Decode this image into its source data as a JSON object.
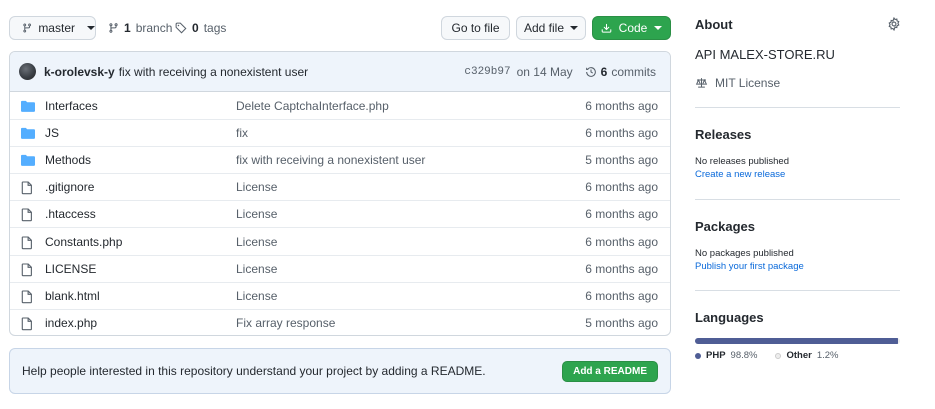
{
  "toolbar": {
    "branch_label": "master",
    "branches_count": "1",
    "branches_label": "branch",
    "tags_count": "0",
    "tags_label": "tags",
    "goto_file": "Go to file",
    "add_file": "Add file",
    "code": "Code"
  },
  "commit": {
    "author": "k-orolevsk-y",
    "message": "fix with receiving a nonexistent user",
    "sha": "c329b97",
    "date": "on 14 May",
    "count": "6",
    "count_label": "commits"
  },
  "files": [
    {
      "name": "Interfaces",
      "type": "folder",
      "message": "Delete CaptchaInterface.php",
      "age": "6 months ago"
    },
    {
      "name": "JS",
      "type": "folder",
      "message": "fix",
      "age": "6 months ago"
    },
    {
      "name": "Methods",
      "type": "folder",
      "message": "fix with receiving a nonexistent user",
      "age": "5 months ago"
    },
    {
      "name": ".gitignore",
      "type": "file",
      "message": "License",
      "age": "6 months ago"
    },
    {
      "name": ".htaccess",
      "type": "file",
      "message": "License",
      "age": "6 months ago"
    },
    {
      "name": "Constants.php",
      "type": "file",
      "message": "License",
      "age": "6 months ago"
    },
    {
      "name": "LICENSE",
      "type": "file",
      "message": "License",
      "age": "6 months ago"
    },
    {
      "name": "blank.html",
      "type": "file",
      "message": "License",
      "age": "6 months ago"
    },
    {
      "name": "index.php",
      "type": "file",
      "message": "Fix array response",
      "age": "5 months ago"
    }
  ],
  "readme": {
    "text": "Help people interested in this repository understand your project by adding a README.",
    "button": "Add a README"
  },
  "about": {
    "heading": "About",
    "description": "API MALEX-STORE.RU",
    "license": "MIT License"
  },
  "releases": {
    "heading": "Releases",
    "none": "No releases published",
    "link": "Create a new release"
  },
  "packages": {
    "heading": "Packages",
    "none": "No packages published",
    "link": "Publish your first package"
  },
  "languages": {
    "heading": "Languages",
    "items": [
      {
        "name": "PHP",
        "percent": "98.8%",
        "value": 98.8,
        "color": "#4F5D95"
      },
      {
        "name": "Other",
        "percent": "1.2%",
        "value": 1.2,
        "color": "#ededed"
      }
    ]
  },
  "colors": {
    "folder_icon": "#54aeff",
    "link": "#0969da",
    "primary_button": "#2da44e"
  }
}
